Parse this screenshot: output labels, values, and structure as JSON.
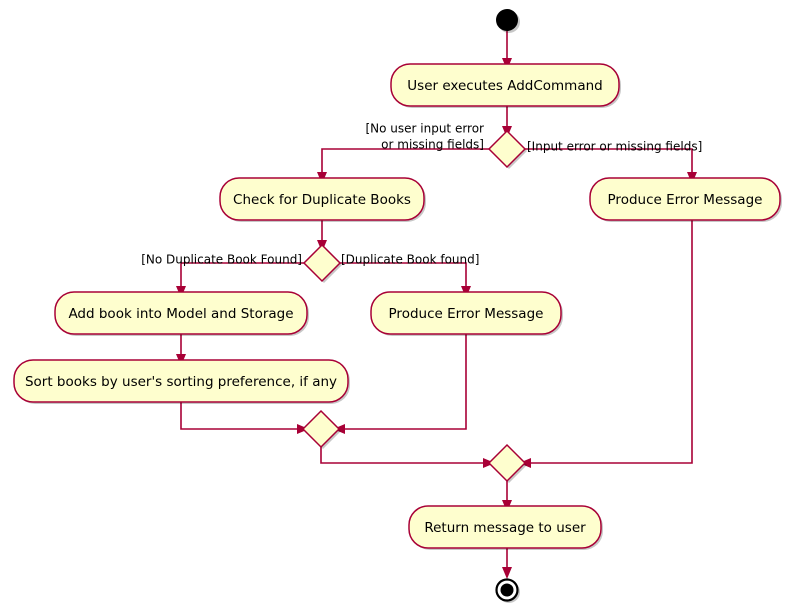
{
  "diagram": {
    "type": "uml-activity-diagram",
    "title": "AddCommand activity diagram",
    "colors": {
      "node_fill": "#FEFECE",
      "node_border": "#A80036",
      "flow_line": "#A80036",
      "text": "#000000",
      "background": "#FFFFFF",
      "terminal": "#000000"
    },
    "nodes": {
      "start": {
        "kind": "initial-node"
      },
      "user_executes": {
        "kind": "activity",
        "label": "User executes AddCommand"
      },
      "decision_input": {
        "kind": "decision"
      },
      "check_duplicate": {
        "kind": "activity",
        "label": "Check for Duplicate Books"
      },
      "decision_duplicate": {
        "kind": "decision"
      },
      "add_book": {
        "kind": "activity",
        "label": "Add book into Model and Storage"
      },
      "sort_books": {
        "kind": "activity",
        "label": "Sort books by user's sorting preference, if any"
      },
      "produce_error_duplicate": {
        "kind": "activity",
        "label": "Produce Error Message"
      },
      "produce_error_input": {
        "kind": "activity",
        "label": "Produce Error Message"
      },
      "merge_inner": {
        "kind": "merge"
      },
      "merge_outer": {
        "kind": "merge"
      },
      "return_message": {
        "kind": "activity",
        "label": "Return message to user"
      },
      "end": {
        "kind": "final-node"
      }
    },
    "guards": {
      "no_input_error_line1": "[No user input error",
      "no_input_error_line2": "or missing fields]",
      "input_error": "[Input error or missing fields]",
      "no_duplicate": "[No Duplicate Book Found]",
      "duplicate_found": "[Duplicate Book found]"
    },
    "edges": [
      {
        "from": "start",
        "to": "user_executes"
      },
      {
        "from": "user_executes",
        "to": "decision_input"
      },
      {
        "from": "decision_input",
        "to": "check_duplicate",
        "guard": "no_input_error"
      },
      {
        "from": "decision_input",
        "to": "produce_error_input",
        "guard": "input_error"
      },
      {
        "from": "check_duplicate",
        "to": "decision_duplicate"
      },
      {
        "from": "decision_duplicate",
        "to": "add_book",
        "guard": "no_duplicate"
      },
      {
        "from": "decision_duplicate",
        "to": "produce_error_duplicate",
        "guard": "duplicate_found"
      },
      {
        "from": "add_book",
        "to": "sort_books"
      },
      {
        "from": "sort_books",
        "to": "merge_inner"
      },
      {
        "from": "produce_error_duplicate",
        "to": "merge_inner"
      },
      {
        "from": "merge_inner",
        "to": "merge_outer"
      },
      {
        "from": "produce_error_input",
        "to": "merge_outer"
      },
      {
        "from": "merge_outer",
        "to": "return_message"
      },
      {
        "from": "return_message",
        "to": "end"
      }
    ]
  }
}
